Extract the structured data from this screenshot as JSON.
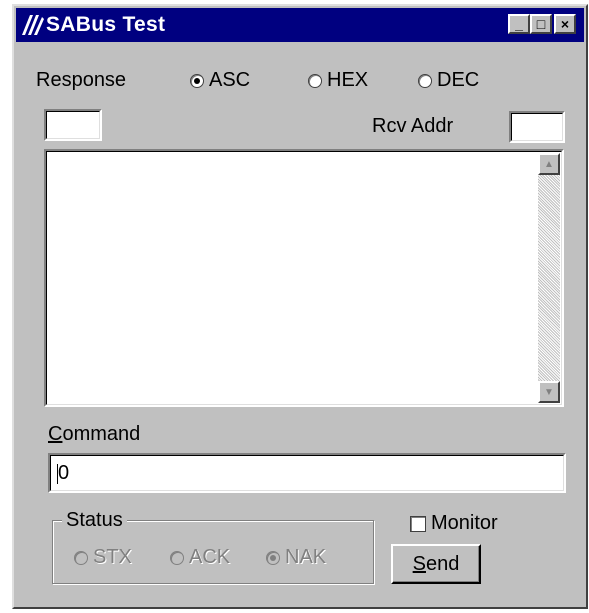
{
  "window": {
    "title": "SABus Test",
    "title_buttons": {
      "minimize": "_",
      "maximize": "□",
      "close": "×"
    }
  },
  "response": {
    "label": "Response",
    "options": [
      {
        "label": "ASC",
        "selected": true
      },
      {
        "label": "HEX",
        "selected": false
      },
      {
        "label": "DEC",
        "selected": false
      }
    ],
    "small_field_value": "",
    "rcv_addr_label": "Rcv Addr",
    "rcv_addr_value": "",
    "output_text": ""
  },
  "command": {
    "label_prefix": "C",
    "label_rest": "ommand",
    "value": "0"
  },
  "status": {
    "label": "Status",
    "options": [
      {
        "label": "STX",
        "selected": false
      },
      {
        "label": "ACK",
        "selected": false
      },
      {
        "label": "NAK",
        "selected": true
      }
    ]
  },
  "monitor": {
    "label": "Monitor",
    "checked": false
  },
  "send": {
    "label_prefix": "S",
    "label_rest": "end"
  },
  "colors": {
    "titlebar": "#000080",
    "face": "#c0c0c0",
    "field": "#ffffff"
  }
}
